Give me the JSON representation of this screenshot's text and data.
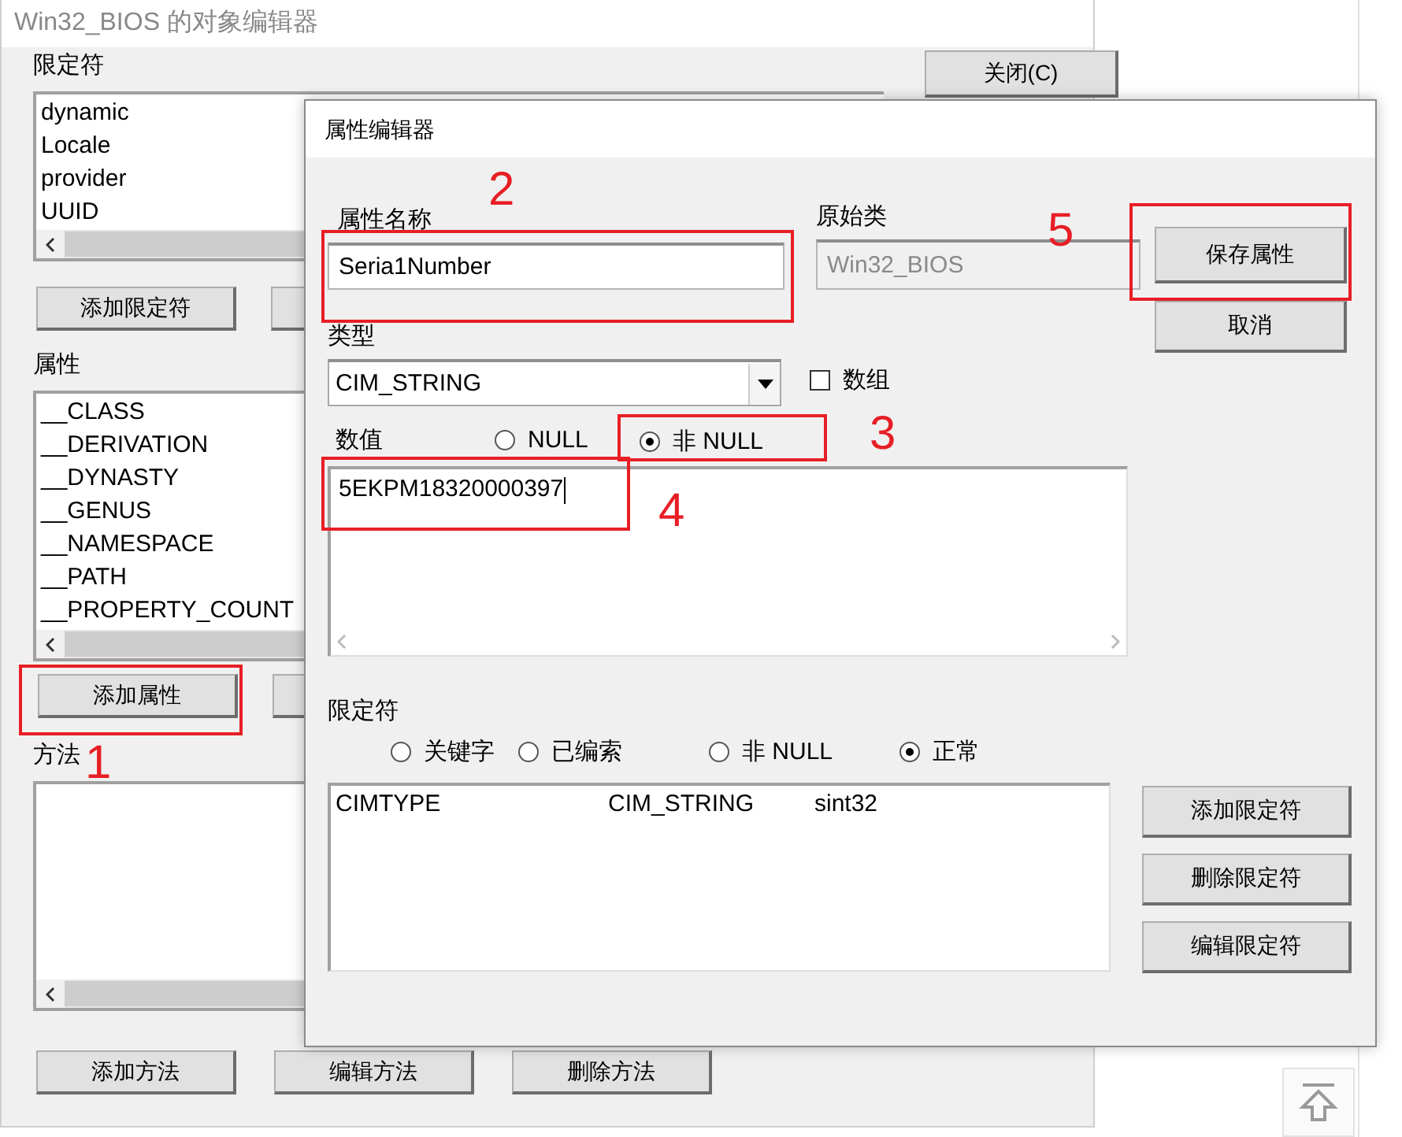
{
  "window": {
    "title": "Win32_BIOS 的对象编辑器",
    "close_button": "关闭(C)"
  },
  "qualifiers": {
    "label": "限定符",
    "items": [
      "dynamic",
      "Locale",
      "provider",
      "UUID"
    ],
    "add_button": "添加限定符"
  },
  "properties": {
    "label": "属性",
    "items": [
      "__CLASS",
      "__DERIVATION",
      "__DYNASTY",
      "__GENUS",
      "__NAMESPACE",
      "__PATH",
      "__PROPERTY_COUNT"
    ],
    "add_button": {
      "label": "添加属性",
      "annotation": "1"
    }
  },
  "methods": {
    "label": "方法",
    "buttons": [
      "添加方法",
      "编辑方法",
      "删除方法"
    ]
  },
  "dialog": {
    "title": "属性编辑器",
    "name_field": {
      "label": "属性名称",
      "value": "Seria1Number",
      "annotation": "2"
    },
    "origin_field": {
      "label": "原始类",
      "value": "Win32_BIOS",
      "disabled": true
    },
    "save_button": {
      "label": "保存属性",
      "annotation": "5"
    },
    "cancel_button": "取消",
    "type_field": {
      "label": "类型",
      "value": "CIM_STRING"
    },
    "array_checkbox": {
      "label": "数组",
      "checked": false
    },
    "value_section": {
      "label": "数值",
      "options": [
        {
          "label": "NULL",
          "selected": false
        },
        {
          "label": "非 NULL",
          "selected": true,
          "annotation": "3"
        }
      ],
      "value": "5EKPM18320000397",
      "annotation": "4"
    },
    "qualifier_section": {
      "label": "限定符",
      "options": [
        {
          "label": "关键字",
          "selected": false
        },
        {
          "label": "已编索",
          "selected": false
        },
        {
          "label": "非 NULL",
          "selected": false
        },
        {
          "label": "正常",
          "selected": true
        }
      ],
      "rows": [
        [
          "CIMTYPE",
          "CIM_STRING",
          "sint32"
        ]
      ],
      "buttons": [
        "添加限定符",
        "删除限定符",
        "编辑限定符"
      ]
    }
  }
}
